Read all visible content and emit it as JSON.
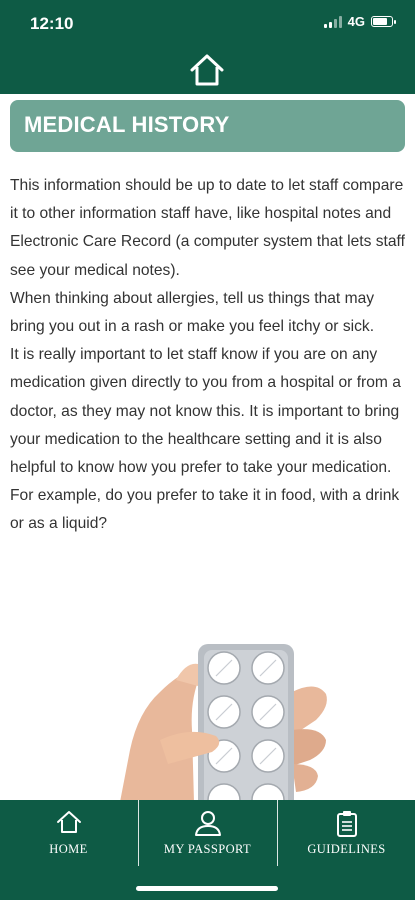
{
  "status_bar": {
    "time": "12:10",
    "network": "4G",
    "battery_level": 0.7
  },
  "section": {
    "title": "MEDICAL HISTORY"
  },
  "body": {
    "paragraphs": [
      "This information should be up to date to let staff compare it to other information staff have, like hospital notes and Electronic Care Record (a computer system that lets staff see your medical notes).",
      "When thinking about allergies, tell us things that may bring you out in a rash or make you feel itchy or sick.",
      "It is really important to let staff know if you are on any medication given directly to you from a hospital or from a doctor, as they may not know this. It is important to bring your medication to the healthcare setting and it is also helpful to know how you prefer to take your medication. For example, do you prefer to take it in food, with a drink or as a liquid?"
    ]
  },
  "bottom_nav": {
    "items": [
      {
        "label": "HOME",
        "icon": "home-icon"
      },
      {
        "label": "MY PASSPORT",
        "icon": "person-icon"
      },
      {
        "label": "GUIDELINES",
        "icon": "clipboard-icon"
      }
    ]
  },
  "colors": {
    "brand_green": "#0e5b45",
    "banner_green": "#6fa595",
    "text": "#333333"
  }
}
